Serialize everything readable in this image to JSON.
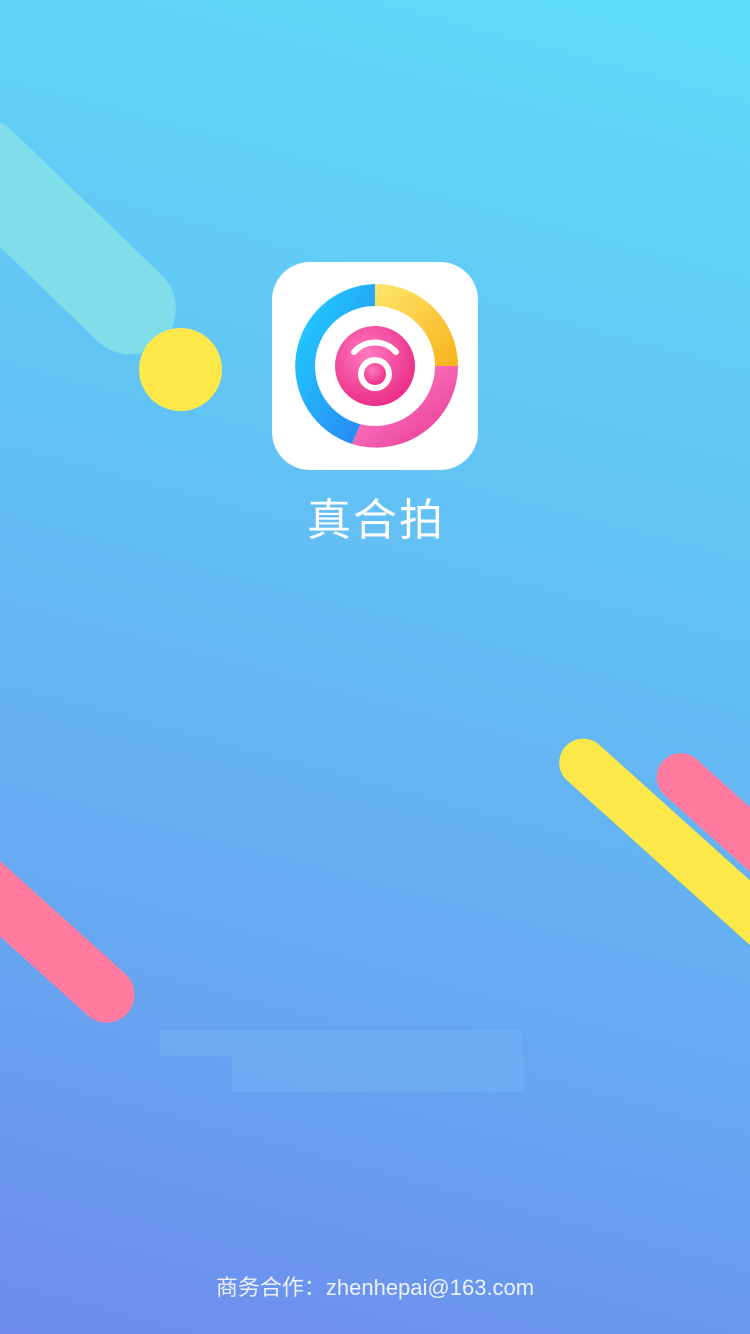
{
  "app": {
    "name": "真合拍",
    "icon": "camera-lens-logo-icon"
  },
  "footer": {
    "text": "商务合作：zhenhepai@163.com"
  },
  "colors": {
    "background_top": "#5fdcf8",
    "background_bottom": "#6d8ced",
    "accent_yellow": "#fde84a",
    "accent_pink": "#ff7ca0",
    "accent_cyan": "#7fdeea"
  }
}
